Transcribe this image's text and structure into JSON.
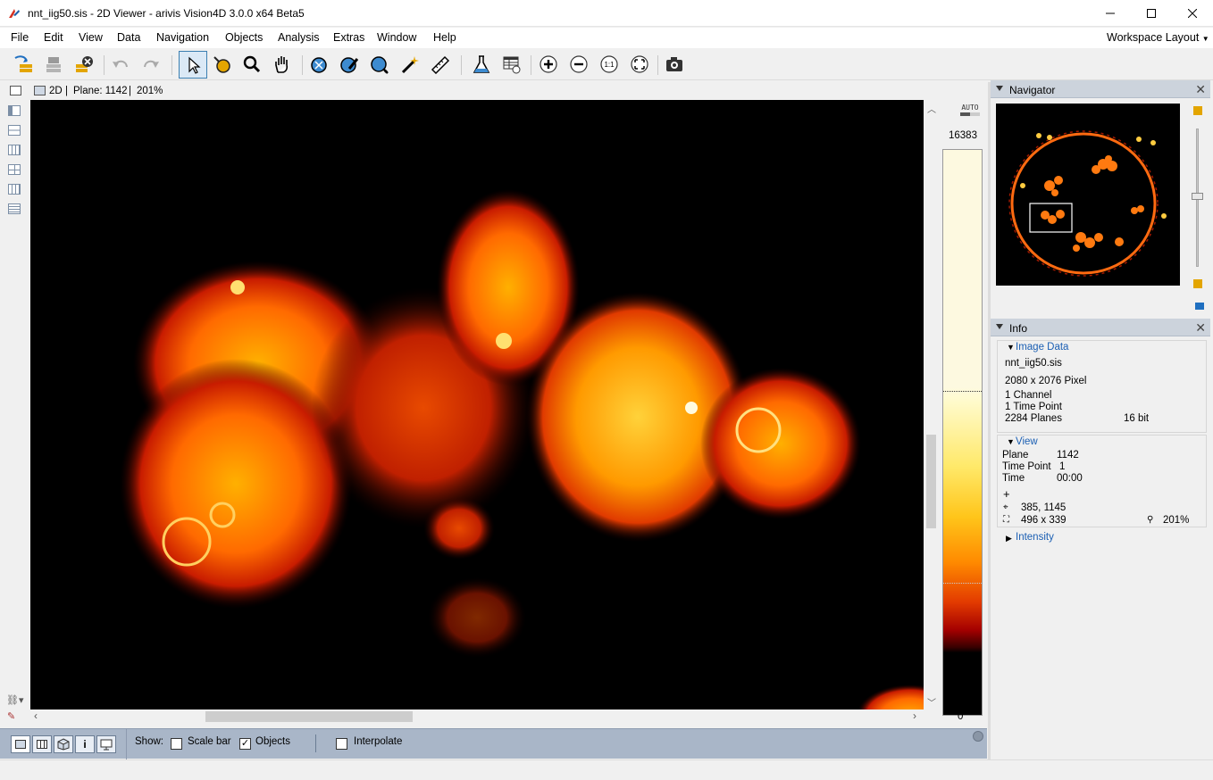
{
  "window": {
    "title": "nnt_iig50.sis - 2D Viewer - arivis Vision4D 3.0.0 x64 Beta5",
    "minimize_label": "—",
    "maximize_label": "☐",
    "close_label": "✕"
  },
  "menu": {
    "items": [
      "File",
      "Edit",
      "View",
      "Data",
      "Navigation",
      "Objects",
      "Analysis",
      "Extras",
      "Window",
      "Help"
    ],
    "workspace_layout": "Workspace Layout"
  },
  "toolbar": {
    "icons": [
      "open-icon",
      "save-icon",
      "close-file-icon",
      "undo-icon",
      "redo-icon",
      "pointer-icon",
      "paint-icon",
      "zoom-icon",
      "pan-hand-icon",
      "object-tool-icon",
      "brush-icon",
      "region-grow-icon",
      "magic-wand-icon",
      "ruler-icon",
      "flask-icon",
      "table-icon",
      "zoom-in-icon",
      "zoom-out-icon",
      "zoom-1to1-icon",
      "fit-icon",
      "camera-icon"
    ],
    "zoom_1to1_label": "1:1",
    "selected_tool": "pointer-icon"
  },
  "viewer": {
    "mode": "2D",
    "plane_label": "Plane: 1142",
    "zoom": "201%",
    "separator": "|"
  },
  "colorbar": {
    "auto_label": "AUTO",
    "max_value": "16383",
    "min_value": "0",
    "colors": {
      "high": "#fdf9e0",
      "mid": "#ffc51a",
      "low": "#a40000",
      "bottom": "#000000"
    }
  },
  "bottom_bar": {
    "show_label": "Show:",
    "scale_bar_label": "Scale bar",
    "scale_bar_checked": false,
    "objects_label": "Objects",
    "objects_checked": true,
    "interpolate_label": "Interpolate",
    "interpolate_checked": false,
    "view_mode_icons": [
      "2d-view-icon",
      "gallery-view-icon",
      "3d-view-icon",
      "info-view-icon",
      "presentation-view-icon"
    ],
    "info_glyph": "i"
  },
  "navigator": {
    "title": "Navigator",
    "close_label": "✕"
  },
  "info": {
    "title": "Info",
    "close_label": "✕",
    "image_data": {
      "header": "Image Data",
      "filename": "nnt_iig50.sis",
      "size": "2080 x 2076 Pixel",
      "channels": "1 Channel",
      "time_points": "1 Time Point",
      "planes": "2284 Planes",
      "bit_depth": "16 bit"
    },
    "view": {
      "header": "View",
      "plane_label": "Plane",
      "plane_value": "1142",
      "time_point_label": "Time Point",
      "time_point_value": "1",
      "time_label": "Time",
      "time_value": "00:00",
      "cursor_glyph": "+",
      "position": "385, 1145",
      "region": "496 x 339",
      "zoom": "201%"
    },
    "intensity_header": "Intensity"
  }
}
